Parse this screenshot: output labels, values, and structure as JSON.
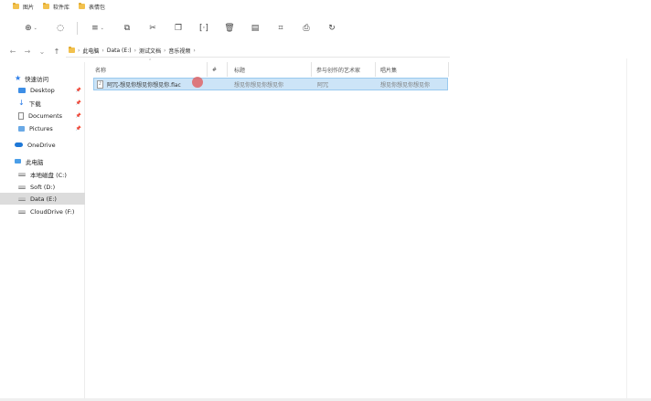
{
  "tabs": [
    {
      "label": "图片"
    },
    {
      "label": "软件库"
    },
    {
      "label": "表情包"
    }
  ],
  "toolbar": {
    "new_symbol": "⊕",
    "new_caret": "⌄",
    "circle_symbol": "◌",
    "view_symbol": "≡",
    "view_caret": "⌄",
    "copy_symbol": "⧉",
    "cut_symbol": "✂",
    "paste_symbol": "❐",
    "rename_symbol": "[·]",
    "delete_symbol": "🗑",
    "properties_symbol": "▤",
    "crop_symbol": "⌗",
    "share_symbol": "⎙",
    "refresh_symbol": "↻"
  },
  "nav": {
    "back": "←",
    "forward": "→",
    "recent": "⌄",
    "up": "↑"
  },
  "breadcrumb": {
    "separator": "›",
    "items": [
      "此电脑",
      "Data (E:)",
      "测试文档",
      "音乐视频"
    ]
  },
  "sidebar": {
    "items": [
      {
        "label": "快速访问",
        "icon": "star-icon"
      },
      {
        "label": "Desktop",
        "icon": "desktop-icon",
        "pin": "📌"
      },
      {
        "label": "下载",
        "icon": "download-icon",
        "pin": "📌"
      },
      {
        "label": "Documents",
        "icon": "documents-icon",
        "pin": "📌"
      },
      {
        "label": "Pictures",
        "icon": "pictures-icon",
        "pin": "📌"
      },
      {
        "label": "OneDrive",
        "icon": "cloud-icon"
      },
      {
        "label": "此电脑",
        "icon": "pc-icon"
      },
      {
        "label": "本地磁盘 (C:)",
        "icon": "drive-icon"
      },
      {
        "label": "Soft (D:)",
        "icon": "drive-icon"
      },
      {
        "label": "Data (E:)",
        "icon": "drive-icon",
        "selected": true
      },
      {
        "label": "CloudDrive (F:)",
        "icon": "drive-icon"
      }
    ]
  },
  "columns": {
    "name": "名称",
    "number": "#",
    "title": "标题",
    "artist": "参与创作的艺术家",
    "album": "唱片集"
  },
  "files": [
    {
      "name": "阿冗-想见你想见你想见你.flac",
      "number": "",
      "title": "想见你想见你想见你",
      "artist": "阿冗",
      "album": "想见你想见你想见你"
    }
  ],
  "colors": {
    "selection": "#cce4f7",
    "selection_border": "#99c9ef",
    "accent": "#2b7de9",
    "cursor": "#e25454"
  }
}
